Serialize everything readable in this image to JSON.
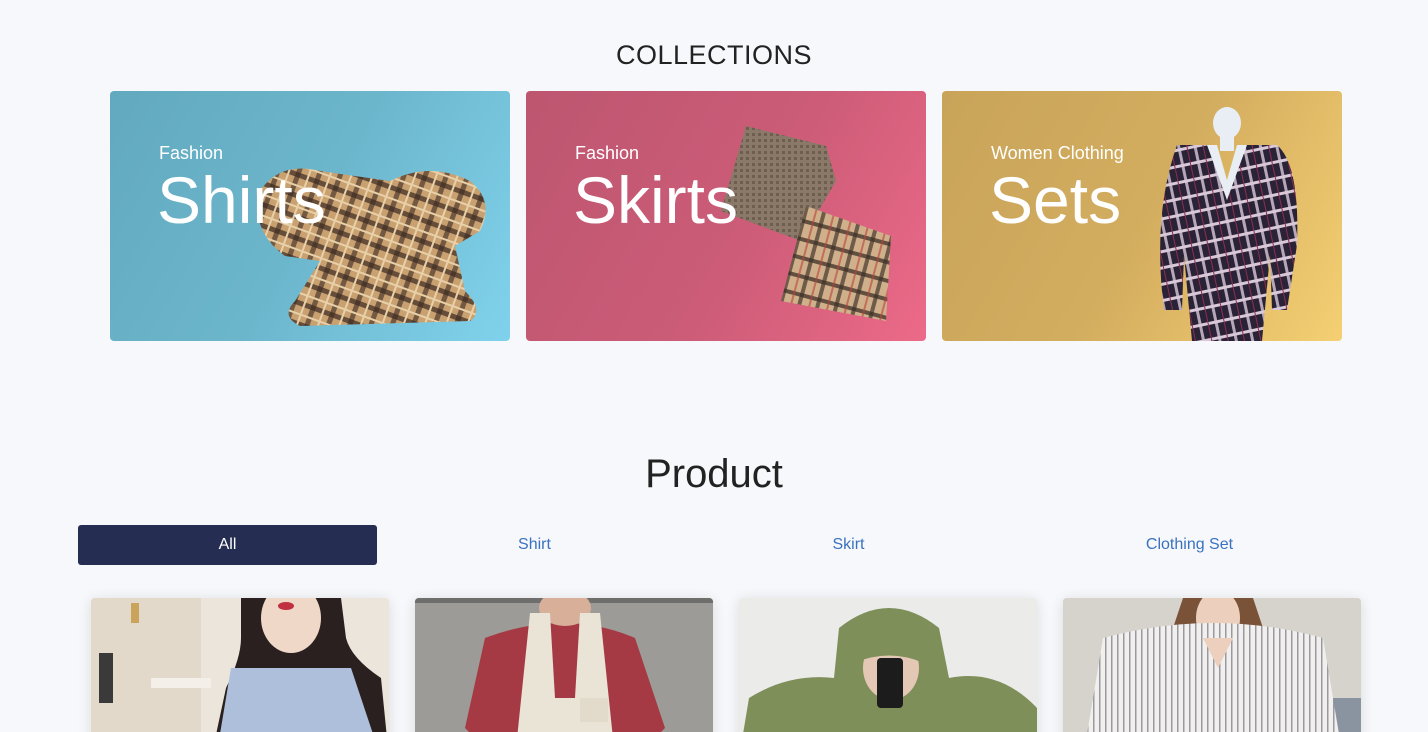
{
  "collections": {
    "title": "COLLECTIONS",
    "cards": [
      {
        "eyebrow": "Fashion",
        "title": "Shirts"
      },
      {
        "eyebrow": "Fashion",
        "title": "Skirts"
      },
      {
        "eyebrow": "Women Clothing",
        "title": "Sets"
      }
    ]
  },
  "product": {
    "title": "Product",
    "tabs": [
      {
        "label": "All",
        "active": true
      },
      {
        "label": "Shirt",
        "active": false
      },
      {
        "label": "Skirt",
        "active": false
      },
      {
        "label": "Clothing Set",
        "active": false
      }
    ]
  },
  "colors": {
    "tab_active_bg": "#252e52",
    "tab_link": "#3a72c0",
    "card_shirts": "#6cb6cc",
    "card_skirts": "#cc5c78",
    "card_sets": "#d3ad5f"
  }
}
